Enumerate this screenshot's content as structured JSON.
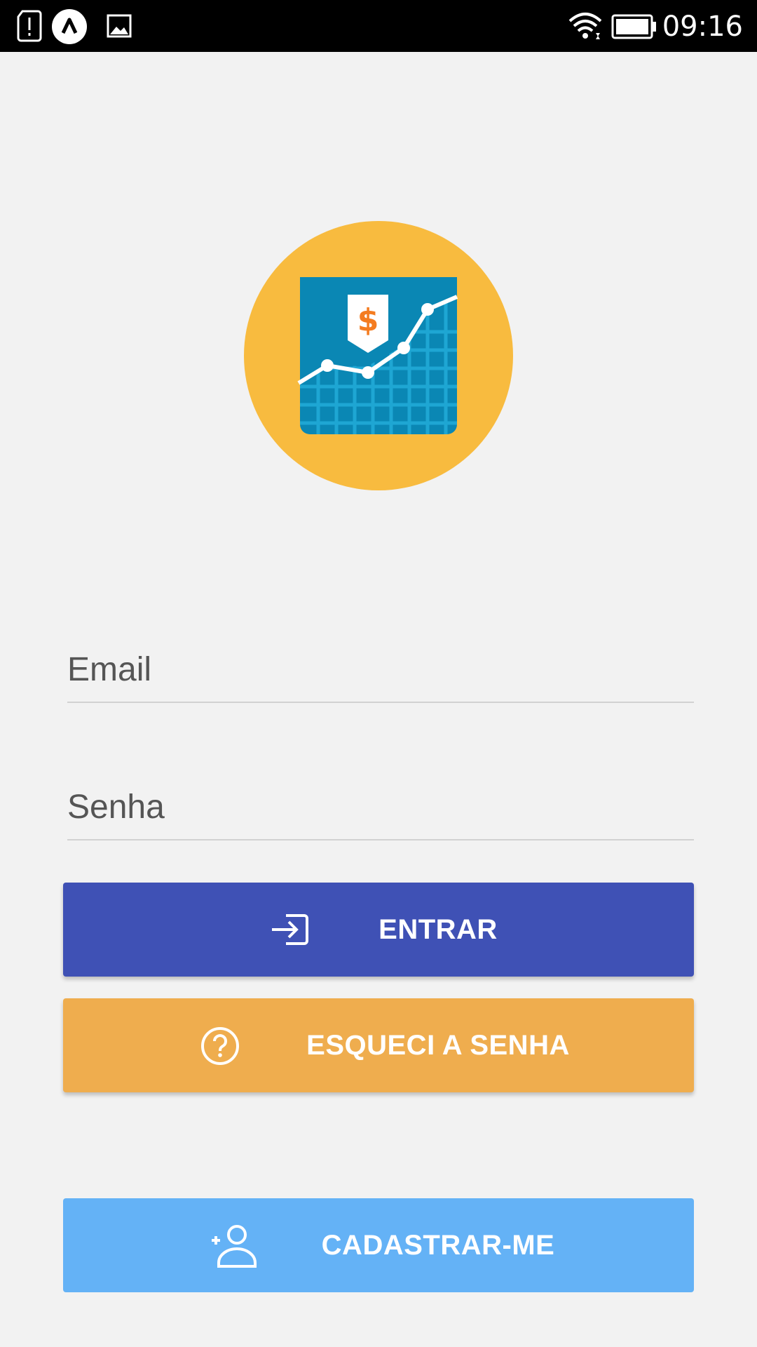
{
  "status_bar": {
    "time": "09:16",
    "icons": [
      "alert-icon",
      "launcher-icon",
      "image-icon",
      "wifi-icon",
      "battery-icon"
    ]
  },
  "logo": {
    "icon": "finance-chart-logo",
    "colors": {
      "circle": "#f8bb3f",
      "tile": "#0a87b4",
      "tag_symbol": "#f47c20"
    }
  },
  "form": {
    "email_placeholder": "Email",
    "email_value": "",
    "password_placeholder": "Senha",
    "password_value": ""
  },
  "buttons": {
    "login": {
      "label": "ENTRAR",
      "icon": "login-icon",
      "color": "#3f51b5"
    },
    "forgot": {
      "label": "ESQUECI A SENHA",
      "icon": "help-circle-icon",
      "color": "#efad4e"
    },
    "register": {
      "label": "CADASTRAR-ME",
      "icon": "add-user-icon",
      "color": "#64b2f6"
    }
  }
}
